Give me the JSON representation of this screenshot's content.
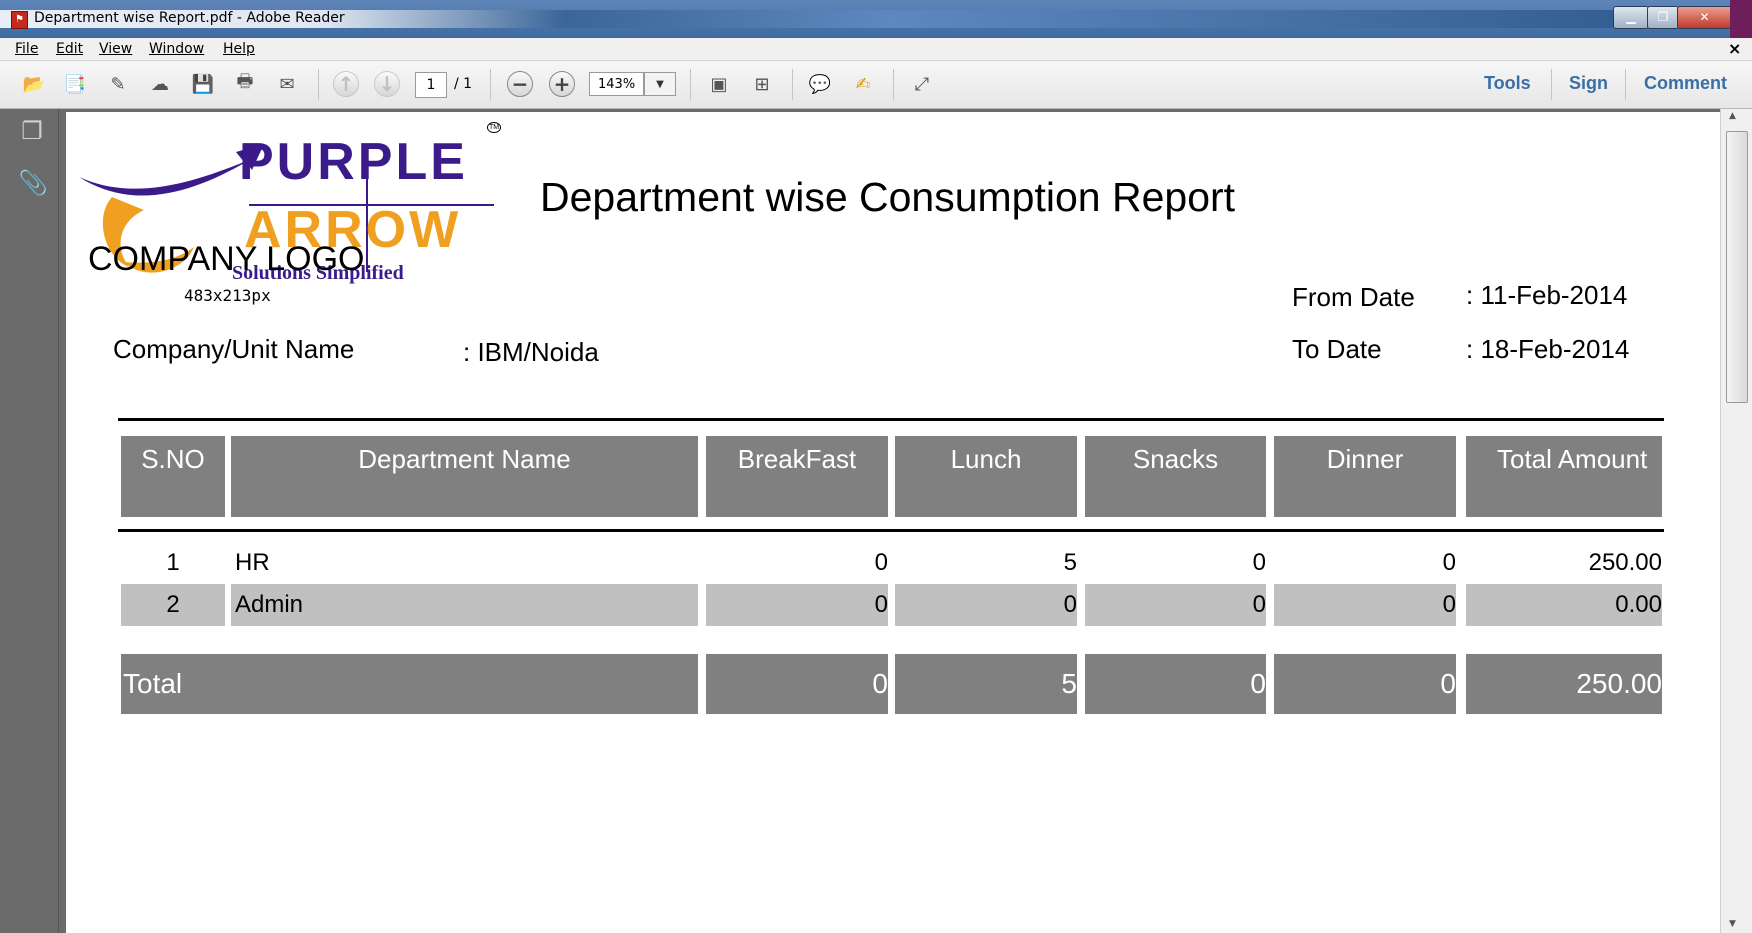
{
  "window": {
    "title": "Department wise Report.pdf - Adobe Reader",
    "app_icon": "pdf-icon"
  },
  "menu": [
    "File",
    "Edit",
    "View",
    "Window",
    "Help"
  ],
  "toolbar": {
    "page_current": "1",
    "page_total": "/ 1",
    "zoom": "143%",
    "right_links": [
      "Tools",
      "Sign",
      "Comment"
    ]
  },
  "document": {
    "logo": {
      "word1": "PURPLE",
      "word2": "ARROW",
      "tagline": "Solutions Simplified",
      "tm": "TM",
      "placeholder_title": "COMPANY LOGO",
      "placeholder_size": "483x213px"
    },
    "report_title": "Department wise Consumption Report",
    "company_label": "Company/Unit Name",
    "company_value": ": IBM/Noida",
    "from_label": "From Date",
    "from_value": ": 11-Feb-2014",
    "to_label": "To Date",
    "to_value": ": 18-Feb-2014",
    "table": {
      "headers": [
        "S.NO",
        "Department Name",
        "BreakFast",
        "Lunch",
        "Snacks",
        "Dinner",
        "Total Amount"
      ],
      "rows": [
        [
          "1",
          "HR",
          "0",
          "5",
          "0",
          "0",
          "250.00"
        ],
        [
          "2",
          "Admin",
          "0",
          "0",
          "0",
          "0",
          "0.00"
        ]
      ],
      "total": [
        "Total",
        "0",
        "5",
        "0",
        "0",
        "250.00"
      ]
    }
  },
  "colors": {
    "header_fill": "#808080",
    "alt_row_fill": "#c0c0c0",
    "link_blue": "#3a6ea5",
    "logo_purple": "#3b1b8a",
    "logo_orange": "#f0a020"
  }
}
